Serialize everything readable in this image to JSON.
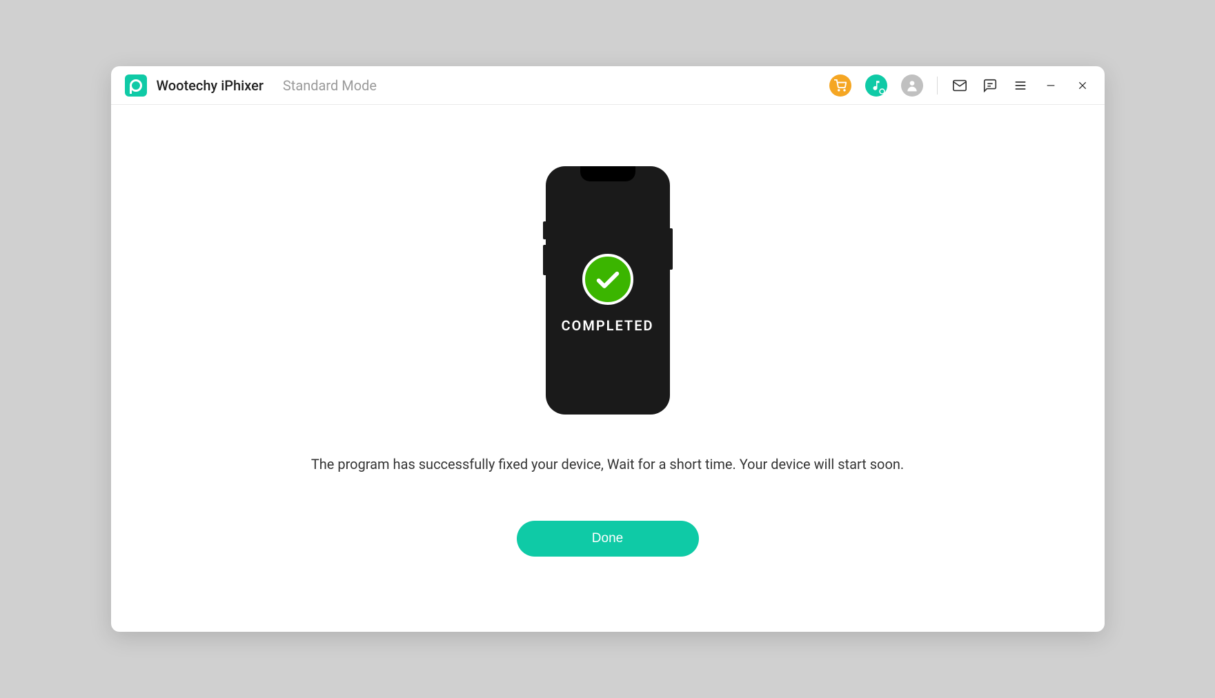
{
  "header": {
    "app_title": "Wootechy iPhixer",
    "mode_label": "Standard Mode",
    "icons": {
      "cart": "cart-icon",
      "music": "music-icon",
      "account": "account-icon",
      "mail": "mail-icon",
      "feedback": "feedback-icon",
      "menu": "menu-icon",
      "minimize": "minimize-icon",
      "close": "close-icon"
    }
  },
  "main": {
    "phone_status": "COMPLETED",
    "message": "The program has successfully fixed your device, Wait for a short time. Your device will start soon.",
    "done_label": "Done"
  },
  "colors": {
    "accent": "#0fcaa6",
    "cart_bg": "#f5a623",
    "success": "#3bb500"
  }
}
